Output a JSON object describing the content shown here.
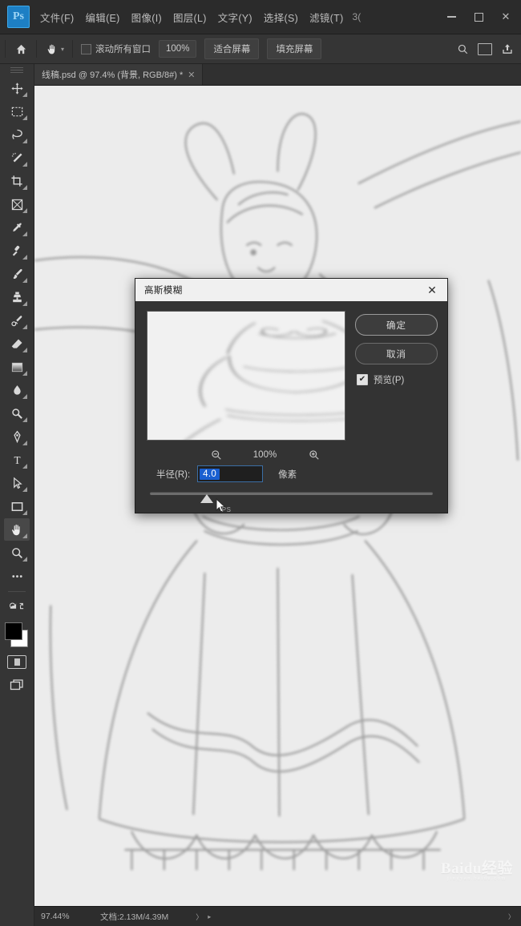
{
  "app": {
    "name": "Adobe Photoshop",
    "logo_text": "Ps",
    "accent_color": "#1d7fc4",
    "chrome_bg": "#2b2b2b"
  },
  "menubar": {
    "items": [
      {
        "label": "文件(F)",
        "name": "menu-file"
      },
      {
        "label": "编辑(E)",
        "name": "menu-edit"
      },
      {
        "label": "图像(I)",
        "name": "menu-image"
      },
      {
        "label": "图层(L)",
        "name": "menu-layer"
      },
      {
        "label": "文字(Y)",
        "name": "menu-type"
      },
      {
        "label": "选择(S)",
        "name": "menu-select"
      },
      {
        "label": "滤镜(T)",
        "name": "menu-filter"
      }
    ],
    "overflow_label": "3(",
    "window_controls": {
      "minimize": "minimize-icon",
      "maximize": "maximize-icon",
      "close": "✕"
    }
  },
  "optionsbar": {
    "home_icon": "home-icon",
    "tool_icon": "hand-tool-icon",
    "tool_caret": "▾",
    "scroll_all_windows_label": "滚动所有窗口",
    "scroll_all_windows_checked": false,
    "zoom_value": "100%",
    "fit_screen_label": "适合屏幕",
    "fill_screen_label": "填充屏幕",
    "search_icon": "search-icon",
    "arrange_icon": "arrange-documents-icon",
    "share_icon": "share-icon"
  },
  "toolbar": {
    "tools": [
      {
        "name": "move-tool",
        "glyph": "move"
      },
      {
        "name": "rectangular-marquee-tool",
        "glyph": "marquee"
      },
      {
        "name": "lasso-tool",
        "glyph": "lasso"
      },
      {
        "name": "magic-wand-tool",
        "glyph": "wand"
      },
      {
        "name": "crop-tool",
        "glyph": "crop"
      },
      {
        "name": "frame-tool",
        "glyph": "frame"
      },
      {
        "name": "eyedropper-tool",
        "glyph": "eyedropper"
      },
      {
        "name": "spot-healing-brush-tool",
        "glyph": "healing"
      },
      {
        "name": "brush-tool",
        "glyph": "brush"
      },
      {
        "name": "clone-stamp-tool",
        "glyph": "stamp"
      },
      {
        "name": "history-brush-tool",
        "glyph": "historybrush"
      },
      {
        "name": "eraser-tool",
        "glyph": "eraser"
      },
      {
        "name": "gradient-tool",
        "glyph": "gradient"
      },
      {
        "name": "blur-tool",
        "glyph": "blur"
      },
      {
        "name": "dodge-tool",
        "glyph": "dodge"
      },
      {
        "name": "pen-tool",
        "glyph": "pen"
      },
      {
        "name": "horizontal-type-tool",
        "glyph": "type"
      },
      {
        "name": "path-selection-tool",
        "glyph": "pathselect"
      },
      {
        "name": "rectangle-tool",
        "glyph": "rectangle"
      },
      {
        "name": "hand-tool",
        "glyph": "hand",
        "active": true
      },
      {
        "name": "zoom-tool",
        "glyph": "zoom"
      },
      {
        "name": "edit-toolbar-tool",
        "glyph": "more"
      }
    ],
    "foreground_color": "#000000",
    "background_color": "#ffffff",
    "quick_mask_icon": "quick-mask-icon",
    "screen_mode_icon": "screen-mode-icon"
  },
  "document": {
    "tab_title": "线稿.psd @ 97.4% (背景, RGB/8#) *",
    "tab_close": "✕"
  },
  "statusbar": {
    "zoom": "97.44%",
    "doc_info": "文档:2.13M/4.39M",
    "arrow": "〉",
    "caret": "▸",
    "right_caret": "〉"
  },
  "dialog": {
    "title": "高斯模糊",
    "close_icon": "✕",
    "ok_label": "确定",
    "cancel_label": "取消",
    "preview_label": "预览(P)",
    "preview_checked": true,
    "preview_check_glyph": "✔",
    "zoom_out_icon": "zoom-out-icon",
    "zoom_in_icon": "zoom-in-icon",
    "preview_zoom": "100%",
    "radius_label": "半径(R):",
    "radius_value": "4.0",
    "radius_unit": "像素",
    "slider_position_pct": 20,
    "cursor_icon": "mouse-pointer-icon",
    "cursor_hint": "PS"
  },
  "watermark": {
    "text": "Baidu经验",
    "subtext": "jingyan.baidu.com"
  }
}
